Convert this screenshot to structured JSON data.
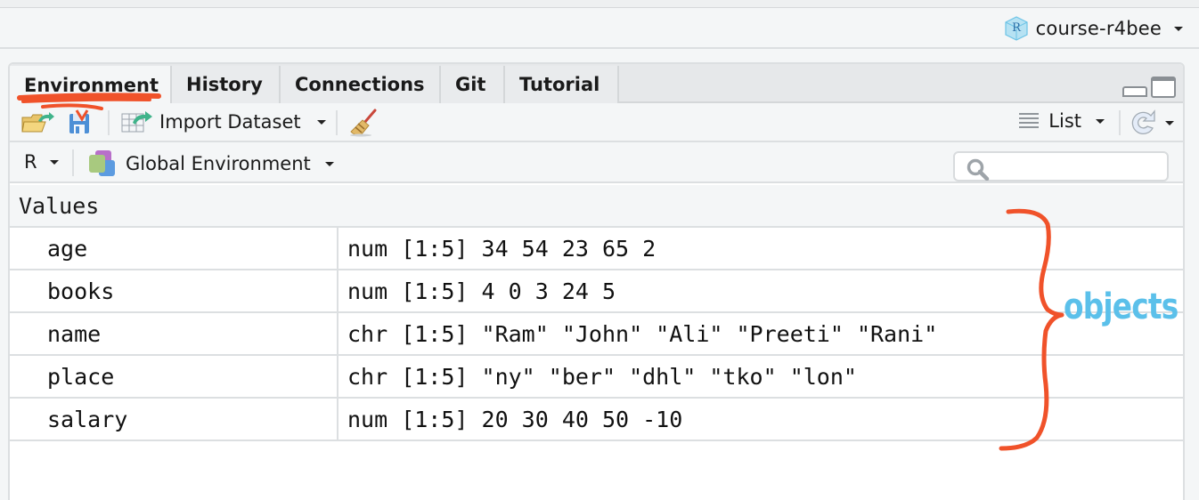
{
  "project": {
    "name": "course-r4bee",
    "icon": "r-project-cube-icon"
  },
  "tabs": [
    {
      "label": "Environment",
      "active": true
    },
    {
      "label": "History",
      "active": false
    },
    {
      "label": "Connections",
      "active": false
    },
    {
      "label": "Git",
      "active": false
    },
    {
      "label": "Tutorial",
      "active": false
    }
  ],
  "toolbar": {
    "import_dataset_label": "Import Dataset",
    "view_mode_label": "List"
  },
  "env_bar": {
    "language_label": "R",
    "environment_label": "Global Environment",
    "search_placeholder": ""
  },
  "values": {
    "section_label": "Values",
    "rows": [
      {
        "name": "age",
        "value": "num [1:5] 34 54 23 65 2"
      },
      {
        "name": "books",
        "value": "num [1:5] 4 0 3 24 5"
      },
      {
        "name": "name",
        "value": "chr [1:5] \"Ram\" \"John\" \"Ali\" \"Preeti\" \"Rani\""
      },
      {
        "name": "place",
        "value": "chr [1:5] \"ny\" \"ber\" \"dhl\" \"tko\" \"lon\""
      },
      {
        "name": "salary",
        "value": "num [1:5] 20 30 40 50 -10"
      }
    ]
  },
  "annotations": {
    "brace_label": "objects",
    "brace_color": "#f0522a",
    "label_color": "#5bc0ea",
    "underline_color": "#f0522a"
  }
}
